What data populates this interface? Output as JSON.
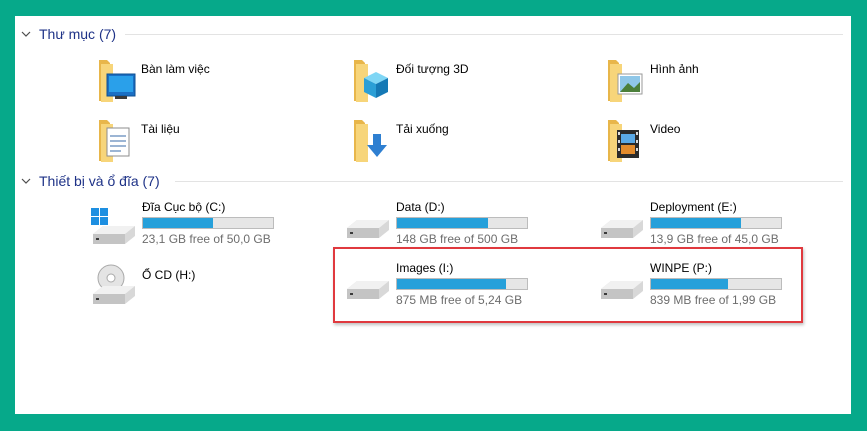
{
  "groups": {
    "folders": {
      "title": "Thư mục (7)"
    },
    "drives": {
      "title": "Thiết bị và ổ đĩa (7)"
    }
  },
  "folders": [
    {
      "label": "Bàn làm việc",
      "icon": "desktop-folder-icon"
    },
    {
      "label": "Đối tượng 3D",
      "icon": "3d-objects-folder-icon"
    },
    {
      "label": "Hình ảnh",
      "icon": "pictures-folder-icon"
    },
    {
      "label": "Tài liệu",
      "icon": "documents-folder-icon"
    },
    {
      "label": "Tải xuống",
      "icon": "downloads-folder-icon"
    },
    {
      "label": "Video",
      "icon": "videos-folder-icon"
    }
  ],
  "drives": [
    {
      "label": "Đĩa Cục bộ (C:)",
      "free": "23,1 GB free of 50,0 GB",
      "used_fraction": 0.54,
      "icon": "windows-drive-icon"
    },
    {
      "label": "Data (D:)",
      "free": "148 GB free of 500 GB",
      "used_fraction": 0.7,
      "icon": "hard-drive-icon"
    },
    {
      "label": "Deployment (E:)",
      "free": "13,9 GB free of 45,0 GB",
      "used_fraction": 0.69,
      "icon": "hard-drive-icon"
    },
    {
      "label": "Ổ CD (H:)",
      "icon": "cd-drive-icon"
    },
    {
      "label": "Images (I:)",
      "free": "875 MB free of 5,24 GB",
      "used_fraction": 0.84,
      "icon": "hard-drive-icon"
    },
    {
      "label": "WINPE (P:)",
      "free": "839 MB free of 1,99 GB",
      "used_fraction": 0.59,
      "icon": "hard-drive-icon"
    }
  ],
  "colors": {
    "frame": "#06a98a",
    "group_title": "#1e3287",
    "usage_bar": "#26a0da",
    "highlight": "#e0393e"
  }
}
